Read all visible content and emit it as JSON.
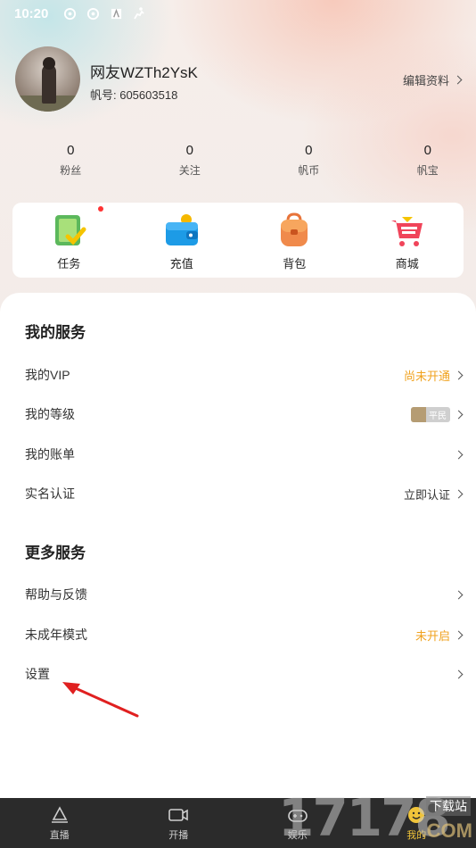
{
  "status_bar": {
    "time": "10:20",
    "icons": [
      "settings-gear-icon",
      "settings-gear-icon",
      "a-app-icon",
      "running-icon"
    ]
  },
  "profile": {
    "username": "网友WZTh2YsK",
    "id_label": "帆号: 605603518",
    "edit_label": "编辑资料"
  },
  "stats": [
    {
      "value": "0",
      "label": "粉丝"
    },
    {
      "value": "0",
      "label": "关注"
    },
    {
      "value": "0",
      "label": "帆币"
    },
    {
      "value": "0",
      "label": "帆宝"
    }
  ],
  "quick_actions": [
    {
      "label": "任务",
      "icon": "task-clipboard-icon",
      "has_dot": true
    },
    {
      "label": "充值",
      "icon": "wallet-icon"
    },
    {
      "label": "背包",
      "icon": "backpack-icon"
    },
    {
      "label": "商城",
      "icon": "shopping-cart-icon"
    }
  ],
  "my_services": {
    "title": "我的服务",
    "items": [
      {
        "label": "我的VIP",
        "value": "尚未开通"
      },
      {
        "label": "我的等级",
        "value": "平民"
      },
      {
        "label": "我的账单",
        "value": ""
      },
      {
        "label": "实名认证",
        "value": "立即认证"
      }
    ]
  },
  "more_services": {
    "title": "更多服务",
    "items": [
      {
        "label": "帮助与反馈",
        "value": ""
      },
      {
        "label": "未成年模式",
        "value": "未开启"
      },
      {
        "label": "设置",
        "value": ""
      }
    ]
  },
  "tabs": [
    {
      "label": "直播",
      "icon": "live-cone-icon"
    },
    {
      "label": "开播",
      "icon": "video-camera-icon"
    },
    {
      "label": "娱乐",
      "icon": "gamepad-icon"
    },
    {
      "label": "我的",
      "icon": "smiley-icon",
      "active": true
    }
  ],
  "watermark": {
    "number": "17178",
    "site": "下载站",
    "domain": ".COM"
  },
  "colors": {
    "accent_orange": "#f0a21e",
    "tab_active": "#f0c43a",
    "tabbar_bg": "#2b2b2b",
    "annotation_arrow": "#e02020"
  }
}
